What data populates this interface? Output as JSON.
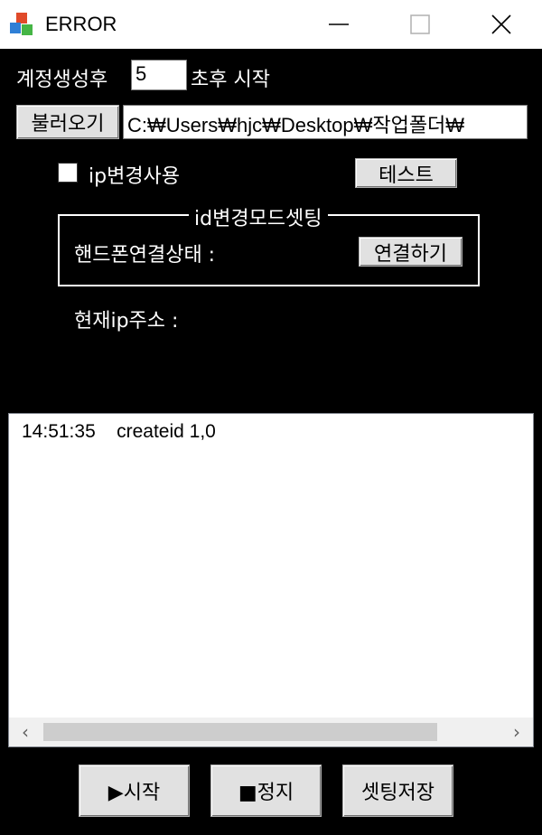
{
  "window": {
    "title": "ERROR"
  },
  "controls": {
    "account_delay_label": "계정생성후",
    "account_delay_value": "5",
    "account_delay_suffix": "초후 시작",
    "load_button": "불러오기",
    "path_value": "C:₩Users₩hjc₩Desktop₩작업폴더₩",
    "ip_change_label": "ip변경사용",
    "ip_change_checked": false,
    "test_button": "테스트",
    "group_title": "id변경모드셋팅",
    "phone_status_label": "핸드폰연결상태 :",
    "connect_button": "연결하기",
    "current_ip_label": "현재ip주소 :"
  },
  "log": {
    "rows": [
      {
        "time": "14:51:35",
        "message": "createid 1,0"
      }
    ]
  },
  "footer": {
    "start_button": "▶시작",
    "stop_button": "■정지",
    "save_button": "셋팅저장"
  }
}
